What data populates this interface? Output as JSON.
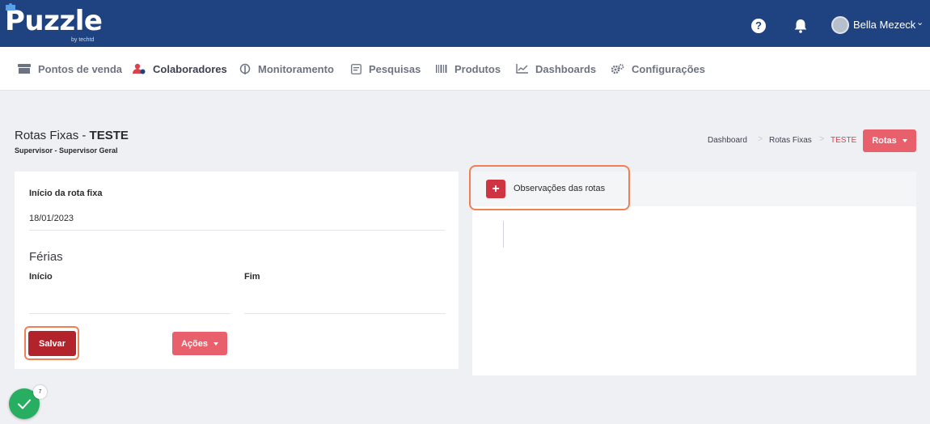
{
  "brand": {
    "name": "Puzzle",
    "tagline": "by techtd",
    "color": "#1f4381"
  },
  "header": {
    "user_name": "Bella Mezeck",
    "help_icon": "question-circle-icon",
    "notification_icon": "bell-icon"
  },
  "nav": {
    "items": [
      {
        "label": "Pontos de venda",
        "icon": "store-icon"
      },
      {
        "label": "Colaboradores",
        "icon": "users-icon",
        "active": true
      },
      {
        "label": "Monitoramento",
        "icon": "monitor-icon"
      },
      {
        "label": "Pesquisas",
        "icon": "survey-icon"
      },
      {
        "label": "Produtos",
        "icon": "barcode-icon"
      },
      {
        "label": "Dashboards",
        "icon": "chart-line-icon"
      },
      {
        "label": "Configurações",
        "icon": "gears-icon"
      }
    ]
  },
  "page": {
    "title_prefix": "Rotas Fixas - ",
    "title_bold": "TESTE",
    "subtitle": "Supervisor - Supervisor Geral"
  },
  "breadcrumb": {
    "items": [
      "Dashboard",
      "Rotas Fixas",
      "TESTE"
    ],
    "separator": ">"
  },
  "actions": {
    "rotas_label": "Rotas"
  },
  "form": {
    "inicio_rota_label": "Início da rota fixa",
    "inicio_rota_value": "18/01/2023",
    "ferias_title": "Férias",
    "ferias_inicio_label": "Início",
    "ferias_inicio_value": "",
    "ferias_fim_label": "Fim",
    "ferias_fim_value": "",
    "save_label": "Salvar",
    "actions_label": "Ações"
  },
  "observations": {
    "add_icon": "plus-icon",
    "label": "Observações das rotas"
  },
  "status_badge": {
    "icon": "check-icon",
    "count": "7"
  },
  "colors": {
    "accent": "#e8606c",
    "save": "#b3232b",
    "highlight": "#f27f54",
    "success": "#27ae60"
  }
}
